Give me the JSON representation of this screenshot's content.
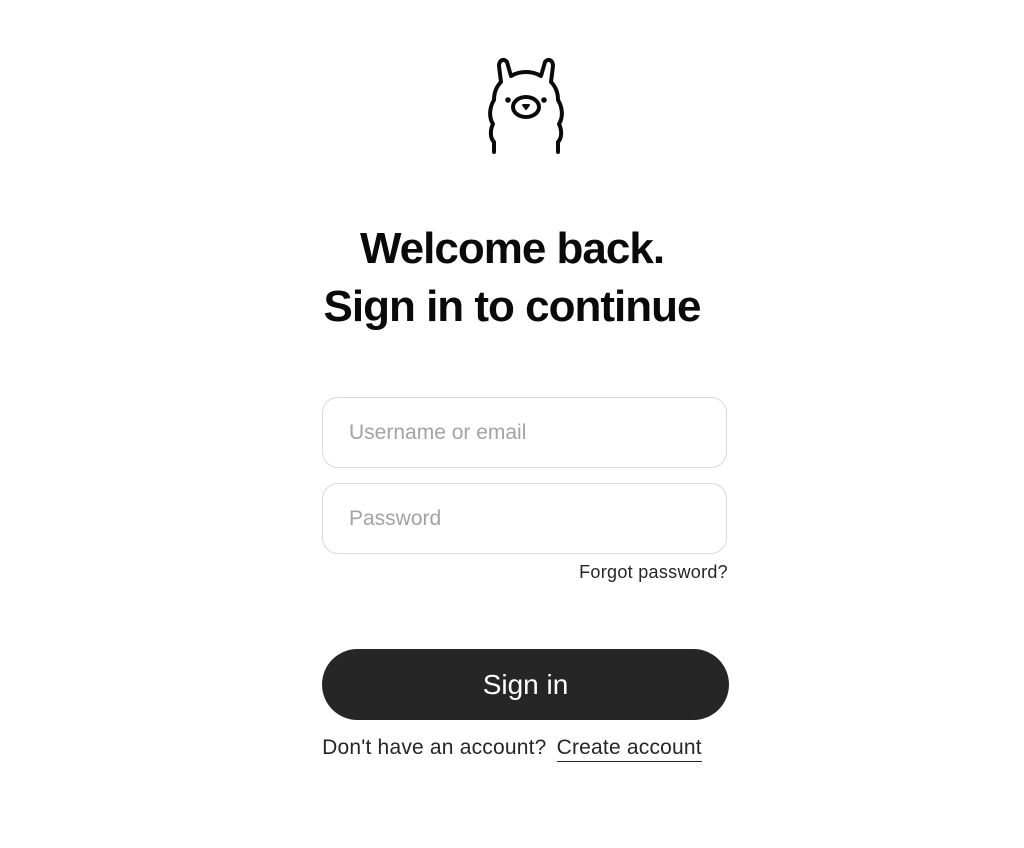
{
  "logo": {
    "icon": "llama-icon"
  },
  "heading": {
    "line1": "Welcome back.",
    "line2": "Sign in to continue"
  },
  "form": {
    "username_placeholder": "Username or email",
    "username_value": "",
    "password_placeholder": "Password",
    "password_value": "",
    "forgot_label": "Forgot password?",
    "signin_label": "Sign in"
  },
  "signup": {
    "prompt": "Don't have an account?",
    "link_label": "Create account"
  },
  "colors": {
    "button_bg": "#262626",
    "field_border": "#d9d9d9",
    "placeholder": "#a3a3a3"
  }
}
